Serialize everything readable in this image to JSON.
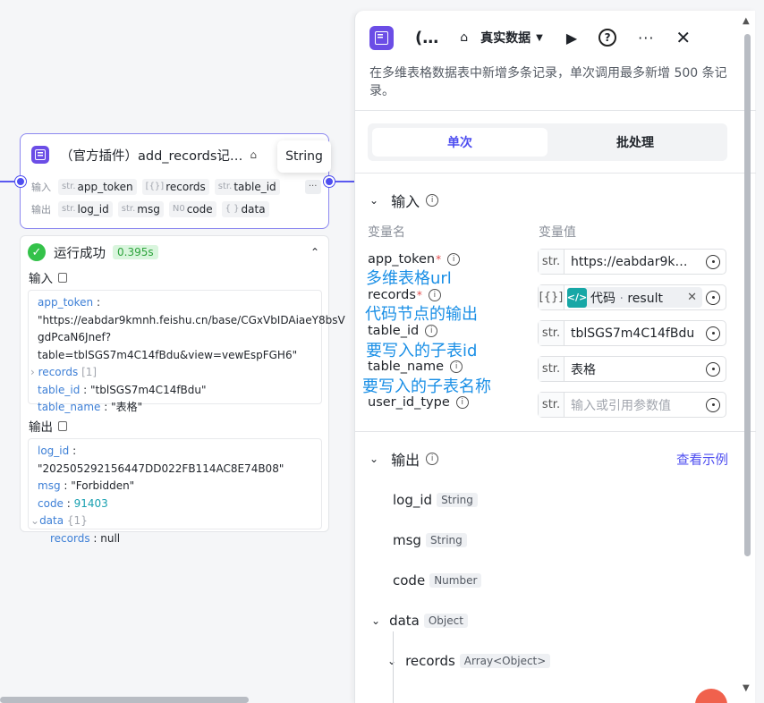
{
  "node": {
    "title": "（官方插件）add_records记…",
    "tooltip": "String",
    "input_label": "输入",
    "output_label": "输出",
    "inputs": [
      {
        "type": "str.",
        "name": "app_token"
      },
      {
        "type": "[{}]",
        "name": "records"
      },
      {
        "type": "str.",
        "name": "table_id"
      }
    ],
    "outputs": [
      {
        "type": "str.",
        "name": "log_id"
      },
      {
        "type": "str.",
        "name": "msg"
      },
      {
        "type": "N0",
        "name": "code"
      },
      {
        "type": "{ }",
        "name": "data"
      }
    ],
    "more": "···"
  },
  "result": {
    "status": "运行成功",
    "time": "0.395s",
    "input_title": "输入",
    "output_title": "输出",
    "input": {
      "app_token_key": "app_token",
      "app_token_value_1": "\"https://eabdar9kmnh.feishu.cn/base/CGxVbIDAiaeY8bsV",
      "app_token_value_2": "gdPcaN6Jnef?",
      "app_token_value_3": "table=tblSGS7m4C14fBdu&view=vewEspFGH6\"",
      "records_key": "records",
      "records_count": "[1]",
      "table_id_key": "table_id",
      "table_id_value": "\"tblSGS7m4C14fBdu\"",
      "table_name_key": "table_name",
      "table_name_value": "\"表格\""
    },
    "output": {
      "log_id_key": "log_id",
      "log_id_value": "\"202505292156447DD022FB114AC8E74B08\"",
      "msg_key": "msg",
      "msg_value": "\"Forbidden\"",
      "code_key": "code",
      "code_value": "91403",
      "data_key": "data",
      "data_count": "{1}",
      "records_key": "records",
      "records_value": "null"
    }
  },
  "drawer": {
    "title": "(…",
    "mode": "真实数据",
    "description": "在多维表格数据表中新增多条记录，单次调用最多新增 500 条记录。",
    "tabs": [
      "单次",
      "批处理"
    ],
    "input_section": "输入",
    "col_name": "变量名",
    "col_value": "变量值",
    "params": [
      {
        "name": "app_token",
        "required": true,
        "type": "str.",
        "value": "https://eabdar9k…",
        "annotation": "多维表格url"
      },
      {
        "name": "records",
        "required": true,
        "type": "[{}]",
        "ref_label": "代码",
        "ref_field": "result",
        "annotation": "代码节点的输出"
      },
      {
        "name": "table_id",
        "required": false,
        "type": "str.",
        "value": "tblSGS7m4C14fBdu",
        "annotation": "要写入的子表id"
      },
      {
        "name": "table_name",
        "required": false,
        "type": "str.",
        "value": "表格",
        "annotation": "要写入的子表名称"
      },
      {
        "name": "user_id_type",
        "required": false,
        "type": "str.",
        "placeholder": "输入或引用参数值"
      }
    ],
    "output_section": "输出",
    "view_example": "查看示例",
    "outputs": [
      {
        "name": "log_id",
        "type": "String"
      },
      {
        "name": "msg",
        "type": "String"
      },
      {
        "name": "code",
        "type": "Number"
      },
      {
        "name": "data",
        "type": "Object"
      },
      {
        "name": "records",
        "type": "Array<Object>"
      }
    ]
  }
}
